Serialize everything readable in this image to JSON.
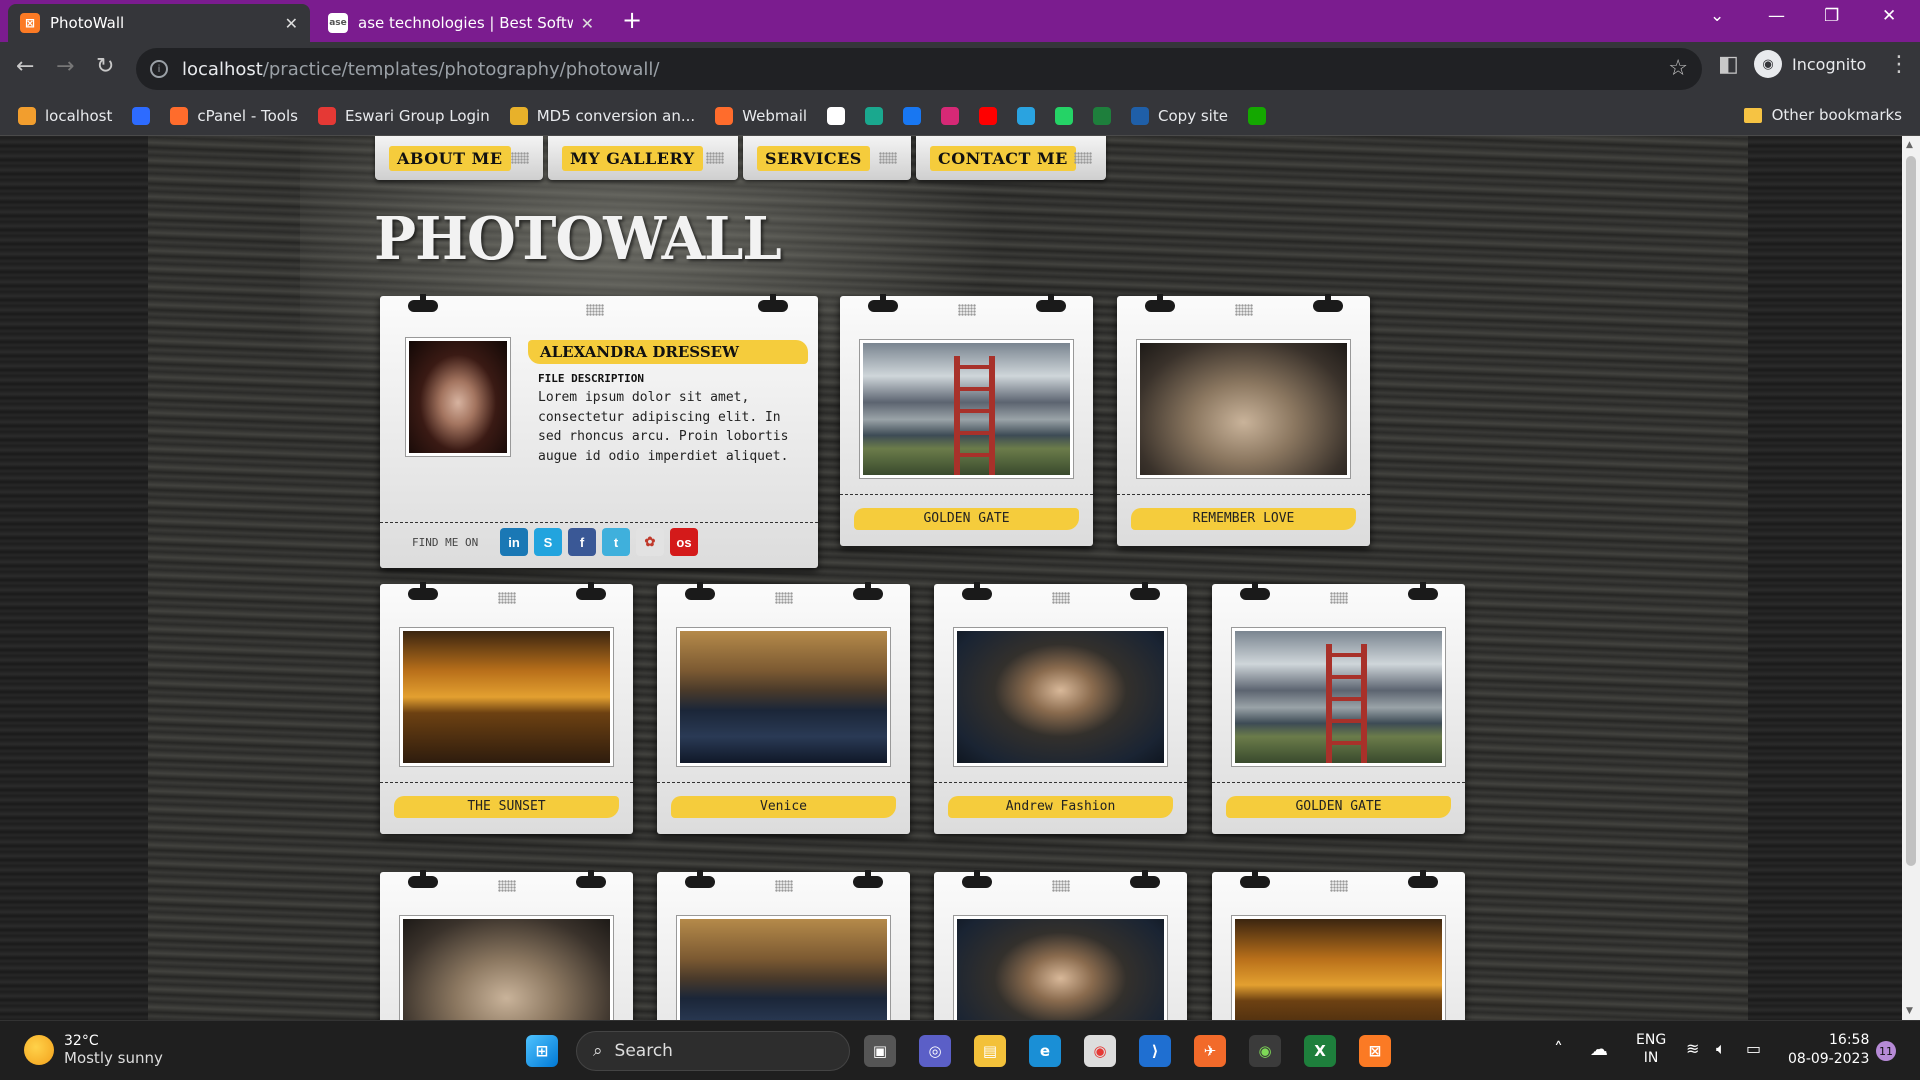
{
  "browser": {
    "tabs": [
      {
        "title": "PhotoWall",
        "favicon": "xampp-icon",
        "active": true
      },
      {
        "title": "ase technologies | Best Software",
        "favicon": "ase-icon",
        "active": false
      }
    ],
    "address": {
      "host": "localhost",
      "path": "/practice/templates/photography/photowall/"
    },
    "profile_label": "Incognito",
    "bookmarks": [
      {
        "label": "localhost",
        "icon": "xampp-bookmark-icon",
        "color": "#f29e2e"
      },
      {
        "label": "",
        "icon": "f-bookmark-icon",
        "color": "#2d6bff"
      },
      {
        "label": "cPanel - Tools",
        "icon": "cpanel-icon",
        "color": "#ff6c2c"
      },
      {
        "label": "Eswari Group Login",
        "icon": "eswari-icon",
        "color": "#e53935"
      },
      {
        "label": "MD5 conversion an...",
        "icon": "key-icon",
        "color": "#e8b12a"
      },
      {
        "label": "Webmail",
        "icon": "cpanel-webmail-icon",
        "color": "#ff6c2c"
      },
      {
        "label": "",
        "icon": "github-icon",
        "color": "#ffffff"
      },
      {
        "label": "",
        "icon": "diamond-icon",
        "color": "#1aa88e"
      },
      {
        "label": "",
        "icon": "facebook-icon",
        "color": "#1877f2"
      },
      {
        "label": "",
        "icon": "instagram-icon",
        "color": "#d62976"
      },
      {
        "label": "",
        "icon": "youtube-icon",
        "color": "#ff0000"
      },
      {
        "label": "",
        "icon": "telegram-icon",
        "color": "#2aa3e0"
      },
      {
        "label": "",
        "icon": "whatsapp-icon",
        "color": "#25d366"
      },
      {
        "label": "",
        "icon": "sheet-icon",
        "color": "#1e7f3c"
      },
      {
        "label": "Copy site",
        "icon": "copy-site-icon",
        "color": "#1f5fa8"
      },
      {
        "label": "",
        "icon": "upwork-icon",
        "color": "#14a800"
      }
    ],
    "other_bookmarks": "Other bookmarks"
  },
  "page": {
    "nav": [
      "ABOUT ME",
      "MY GALLERY",
      "SERVICES",
      "CONTACT ME"
    ],
    "logo": "PHOTOWALL",
    "profile": {
      "name": "ALEXANDRA DRESSEW",
      "desc_title": "FILE DESCRIPTION",
      "desc": "Lorem ipsum dolor sit amet, consectetur adipiscing elit. In sed rhoncus arcu. Proin lobortis augue id odio imperdiet aliquet.",
      "find_me": "FIND ME ON",
      "socials": [
        {
          "name": "linkedin-icon",
          "label": "in",
          "color": "#1a78b5"
        },
        {
          "name": "skype-icon",
          "label": "S",
          "color": "#22a4de"
        },
        {
          "name": "facebook-icon",
          "label": "f",
          "color": "#3a5896"
        },
        {
          "name": "twitter-icon",
          "label": "t",
          "color": "#3fb0dc"
        },
        {
          "name": "picasa-icon",
          "label": "✿",
          "color": "#e2e2e2"
        },
        {
          "name": "lastfm-icon",
          "label": "os",
          "color": "#d41a1a"
        }
      ]
    },
    "gallery": [
      {
        "caption": "GOLDEN GATE",
        "photo": "golden-gate"
      },
      {
        "caption": "REMEMBER LOVE",
        "photo": "remember-love"
      },
      {
        "caption": "THE SUNSET",
        "photo": "sunset"
      },
      {
        "caption": "Venice",
        "photo": "venice"
      },
      {
        "caption": "Andrew Fashion",
        "photo": "fashion"
      },
      {
        "caption": "GOLDEN GATE",
        "photo": "golden-gate"
      },
      {
        "caption": "",
        "photo": "remember-love"
      },
      {
        "caption": "",
        "photo": "venice"
      },
      {
        "caption": "",
        "photo": "fashion"
      },
      {
        "caption": "",
        "photo": "sunset"
      }
    ]
  },
  "taskbar": {
    "weather_temp": "32°C",
    "weather_desc": "Mostly sunny",
    "search": "Search",
    "lang_top": "ENG",
    "lang_bottom": "IN",
    "time": "16:58",
    "date": "08-09-2023",
    "notif_count": "11"
  }
}
